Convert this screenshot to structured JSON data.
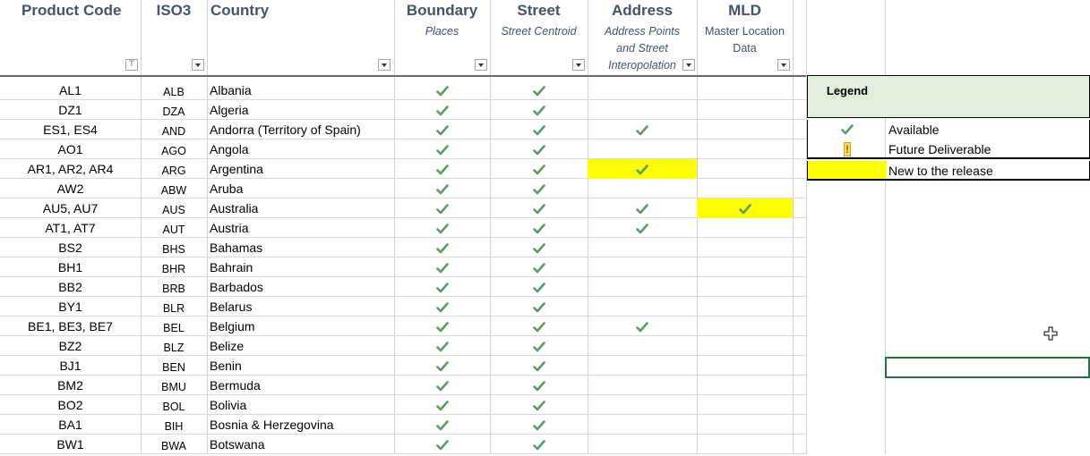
{
  "headers": {
    "product_code": "Product Code",
    "iso3": "ISO3",
    "country": "Country",
    "boundary_title": "Boundary",
    "boundary_sub": "Places",
    "street_title": "Street",
    "street_sub": "Street Centroid",
    "address_title": "Address",
    "address_sub_1": "Address Points",
    "address_sub_2": "and Street",
    "address_sub_3": "Interopolation",
    "mld_title": "MLD",
    "mld_sub_1": "Master Location",
    "mld_sub_2": "Data"
  },
  "colors": {
    "check": "#5b9b6b",
    "highlight": "#ffff00",
    "legend_bg": "#e2efda",
    "header_text": "#44546a"
  },
  "rows": [
    {
      "code": "AL1",
      "iso": "ALB",
      "country": "Albania",
      "boundary": true,
      "street": true,
      "address": false,
      "mld": false,
      "address_new": false,
      "mld_new": false
    },
    {
      "code": "DZ1",
      "iso": "DZA",
      "country": "Algeria",
      "boundary": true,
      "street": true,
      "address": false,
      "mld": false,
      "address_new": false,
      "mld_new": false
    },
    {
      "code": "ES1, ES4",
      "iso": "AND",
      "country": "Andorra (Territory of Spain)",
      "boundary": true,
      "street": true,
      "address": true,
      "mld": false,
      "address_new": false,
      "mld_new": false
    },
    {
      "code": "AO1",
      "iso": "AGO",
      "country": "Angola",
      "boundary": true,
      "street": true,
      "address": false,
      "mld": false,
      "address_new": false,
      "mld_new": false
    },
    {
      "code": "AR1, AR2, AR4",
      "iso": "ARG",
      "country": "Argentina",
      "boundary": true,
      "street": true,
      "address": true,
      "mld": false,
      "address_new": true,
      "mld_new": false
    },
    {
      "code": "AW2",
      "iso": "ABW",
      "country": "Aruba",
      "boundary": true,
      "street": true,
      "address": false,
      "mld": false,
      "address_new": false,
      "mld_new": false
    },
    {
      "code": "AU5, AU7",
      "iso": "AUS",
      "country": "Australia",
      "boundary": true,
      "street": true,
      "address": true,
      "mld": true,
      "address_new": false,
      "mld_new": true
    },
    {
      "code": "AT1, AT7",
      "iso": "AUT",
      "country": "Austria",
      "boundary": true,
      "street": true,
      "address": true,
      "mld": false,
      "address_new": false,
      "mld_new": false
    },
    {
      "code": "BS2",
      "iso": "BHS",
      "country": "Bahamas",
      "boundary": true,
      "street": true,
      "address": false,
      "mld": false,
      "address_new": false,
      "mld_new": false
    },
    {
      "code": "BH1",
      "iso": "BHR",
      "country": "Bahrain",
      "boundary": true,
      "street": true,
      "address": false,
      "mld": false,
      "address_new": false,
      "mld_new": false
    },
    {
      "code": "BB2",
      "iso": "BRB",
      "country": "Barbados",
      "boundary": true,
      "street": true,
      "address": false,
      "mld": false,
      "address_new": false,
      "mld_new": false
    },
    {
      "code": "BY1",
      "iso": "BLR",
      "country": "Belarus",
      "boundary": true,
      "street": true,
      "address": false,
      "mld": false,
      "address_new": false,
      "mld_new": false
    },
    {
      "code": "BE1, BE3, BE7",
      "iso": "BEL",
      "country": "Belgium",
      "boundary": true,
      "street": true,
      "address": true,
      "mld": false,
      "address_new": false,
      "mld_new": false
    },
    {
      "code": "BZ2",
      "iso": "BLZ",
      "country": "Belize",
      "boundary": true,
      "street": true,
      "address": false,
      "mld": false,
      "address_new": false,
      "mld_new": false
    },
    {
      "code": "BJ1",
      "iso": "BEN",
      "country": "Benin",
      "boundary": true,
      "street": true,
      "address": false,
      "mld": false,
      "address_new": false,
      "mld_new": false
    },
    {
      "code": "BM2",
      "iso": "BMU",
      "country": "Bermuda",
      "boundary": true,
      "street": true,
      "address": false,
      "mld": false,
      "address_new": false,
      "mld_new": false
    },
    {
      "code": "BO2",
      "iso": "BOL",
      "country": "Bolivia",
      "boundary": true,
      "street": true,
      "address": false,
      "mld": false,
      "address_new": false,
      "mld_new": false
    },
    {
      "code": "BA1",
      "iso": "BIH",
      "country": "Bosnia & Herzegovina",
      "boundary": true,
      "street": true,
      "address": false,
      "mld": false,
      "address_new": false,
      "mld_new": false
    },
    {
      "code": "BW1",
      "iso": "BWA",
      "country": "Botswana",
      "boundary": true,
      "street": true,
      "address": false,
      "mld": false,
      "address_new": false,
      "mld_new": false
    }
  ],
  "legend": {
    "title": "Legend",
    "available": "Available",
    "future": "Future Deliverable",
    "future_symbol": "!",
    "new_release": "New to the release"
  }
}
